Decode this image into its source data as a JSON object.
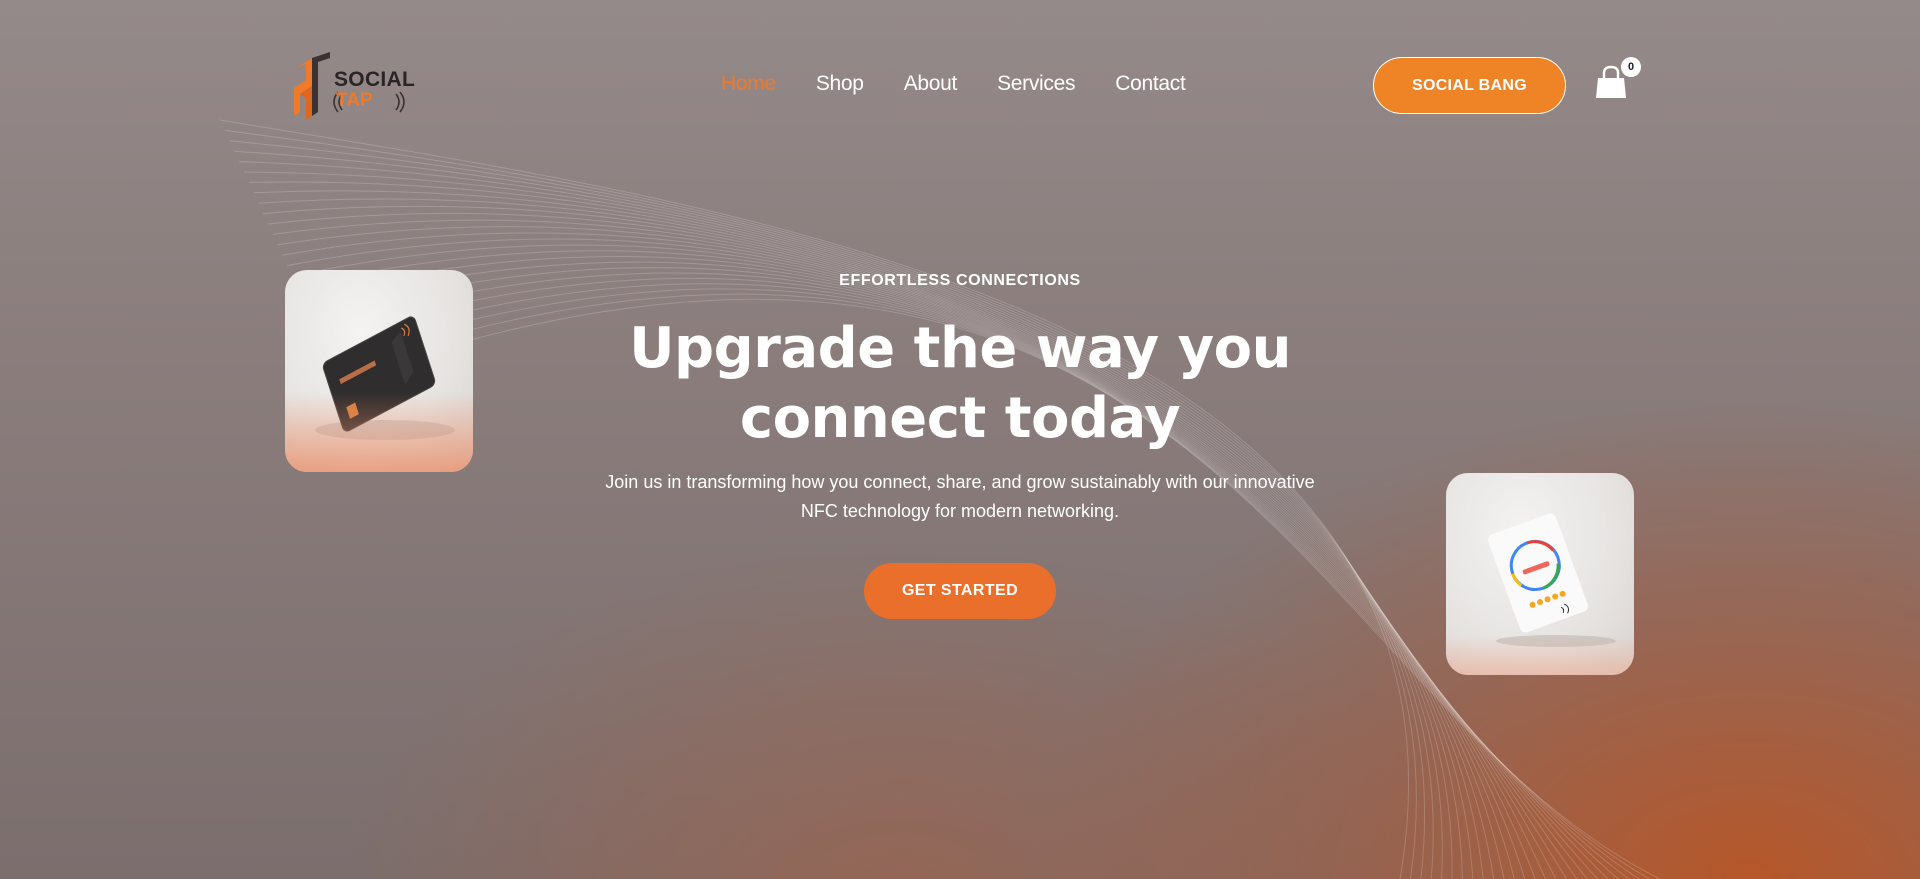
{
  "brand": {
    "logo_line1": "SOCIAL",
    "logo_line2": "TAP",
    "accent_color": "#f07a28",
    "dark_color": "#2a2526"
  },
  "nav": {
    "items": [
      {
        "label": "Home",
        "active": true
      },
      {
        "label": "Shop",
        "active": false
      },
      {
        "label": "About",
        "active": false
      },
      {
        "label": "Services",
        "active": false
      },
      {
        "label": "Contact",
        "active": false
      }
    ]
  },
  "header": {
    "cta_label": "SOCIAL BANG",
    "cart_icon": "shopping-bag-icon",
    "cart_count": "0"
  },
  "hero": {
    "eyebrow": "EFFORTLESS CONNECTIONS",
    "headline_line1": "Upgrade the way you",
    "headline_line2": "connect today",
    "subtext_line1": "Join us in transforming how you connect, share, and grow sustainably with our innovative",
    "subtext_line2": "NFC technology for modern networking.",
    "cta_label": "GET STARTED"
  },
  "images": {
    "left_card": "nfc-business-card-image",
    "right_card": "google-review-card-image"
  }
}
